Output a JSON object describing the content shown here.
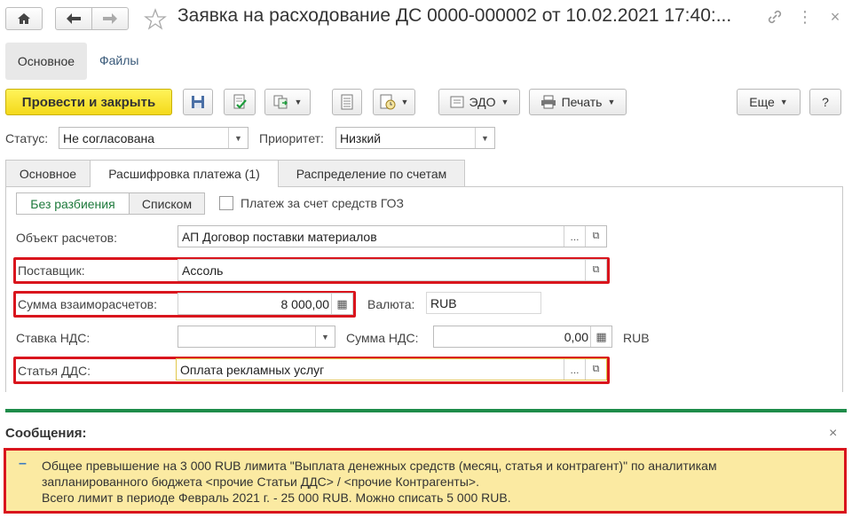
{
  "window": {
    "title": "Заявка на расходование ДС 0000-000002 от 10.02.2021 17:40:..."
  },
  "nav": {
    "main": "Основное",
    "files": "Файлы"
  },
  "toolbar": {
    "post_close": "Провести и закрыть",
    "edo": "ЭДО",
    "print": "Печать",
    "more": "Еще",
    "help": "?"
  },
  "status": {
    "label": "Статус:",
    "value": "Не согласована"
  },
  "priority": {
    "label": "Приоритет:",
    "value": "Низкий"
  },
  "tabs": [
    "Основное",
    "Расшифровка платежа (1)",
    "Распределение по счетам"
  ],
  "split": {
    "no_split": "Без разбиения",
    "list": "Списком"
  },
  "goz_checkbox": {
    "label": "Платеж за счет средств ГОЗ",
    "checked": false
  },
  "form": {
    "object_label": "Объект расчетов:",
    "object_value": "АП Договор поставки материалов",
    "supplier_label": "Поставщик:",
    "supplier_value": "Ассоль",
    "amount_label": "Сумма взаиморасчетов:",
    "amount_value": "8 000,00",
    "currency_label": "Валюта:",
    "currency_value": "RUB",
    "vat_rate_label": "Ставка НДС:",
    "vat_rate_value": "",
    "vat_sum_label": "Сумма НДС:",
    "vat_sum_value": "0,00",
    "vat_currency": "RUB",
    "dds_label": "Статья ДДС:",
    "dds_value": "Оплата рекламных услуг"
  },
  "messages": {
    "header": "Сообщения:",
    "bullet": "–",
    "line1": "Общее превышение на 3 000 RUB лимита \"Выплата денежных средств (месяц, статья и контрагент)\" по аналитикам",
    "line2": "запланированного бюджета <прочие Статьи ДДС> / <прочие Контрагенты>.",
    "line3": "Всего лимит в периоде Февраль 2021 г. - 25 000 RUB. Можно списать 5 000 RUB."
  },
  "colors": {
    "primary_button": "#f4d91a",
    "highlight_border": "#d9151d",
    "separator": "#1e8c4a",
    "message_bg": "#fbeaa2",
    "link": "#3a5a7a",
    "active_segment": "#1e7a3c"
  }
}
